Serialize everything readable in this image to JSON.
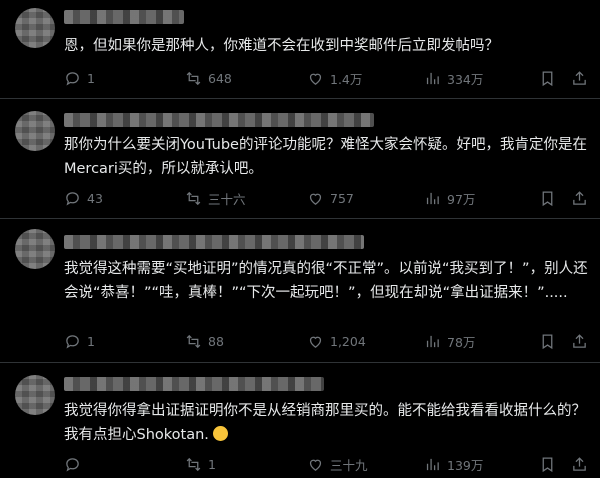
{
  "posts": [
    {
      "text": "恩，但如果你是那种人，你难道不会在收到中奖邮件后立即发帖吗？",
      "replies": "1",
      "reposts": "648",
      "likes": "1.4万",
      "views": "334万"
    },
    {
      "text": "那你为什么要关闭YouTube的评论功能呢？难怪大家会怀疑。好吧，我肯定你是在Mercari买的，所以就承认吧。",
      "replies": "43",
      "reposts": "三十六",
      "likes": "757",
      "views": "97万"
    },
    {
      "text": "我觉得这种需要“买地证明”的情况真的很“不正常”。以前说“我买到了！”，别人还会说“恭喜！”“哇，真棒！”“下次一起玩吧！”，但现在却说“拿出证据来！”.....",
      "replies": "1",
      "reposts": "88",
      "likes": "1,204",
      "views": "78万"
    },
    {
      "text": "我觉得你得拿出证据证明你不是从经销商那里买的。能不能给我看看收据什么的？我有点担心Shokotan.",
      "replies": "",
      "reposts": "1",
      "likes": "三十九",
      "views": "139万"
    }
  ],
  "colors": {
    "background": "#000000",
    "text": "#e7e9ea",
    "muted": "#71767b",
    "divider": "#2f3336"
  },
  "icons": [
    "reply-icon",
    "repost-icon",
    "like-icon",
    "views-icon",
    "bookmark-icon",
    "share-icon"
  ]
}
